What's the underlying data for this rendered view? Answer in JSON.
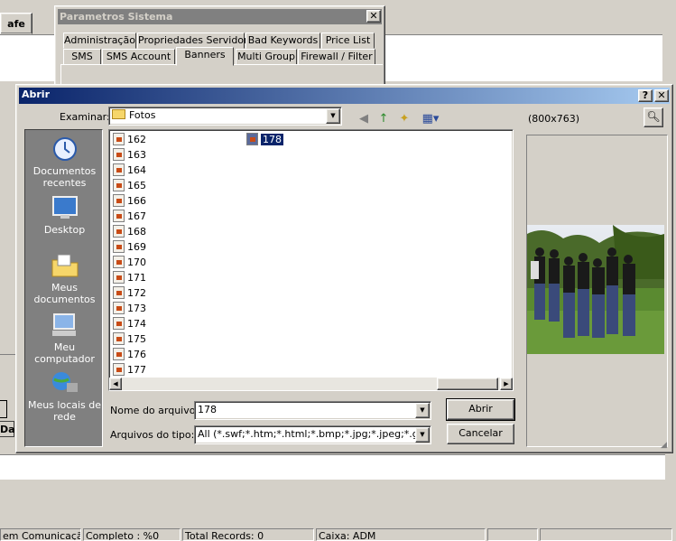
{
  "background": {
    "tab_label": "afe",
    "da_label": "Da"
  },
  "status_bar": {
    "cells": [
      "em Comunicação :",
      "Completo : %0",
      "Total Records: 0",
      "Caixa: ADM"
    ]
  },
  "param_dialog": {
    "title": "Parametros Sistema",
    "tabs_row1": [
      "Administração",
      "Propriedades Servidor",
      "Bad Keywords",
      "Price List"
    ],
    "tabs_row2": [
      "SMS",
      "SMS Account",
      "Banners",
      "Multi Group",
      "Firewall / Filter"
    ],
    "active_tab": "Banners"
  },
  "open_dialog": {
    "title": "Abrir",
    "help_btn": "?",
    "close_btn": "✕",
    "look_in_label": "Examinar:",
    "look_in_value": "Fotos",
    "preview_size": "(800x763)",
    "places": [
      {
        "label": "Documentos recentes",
        "icon": "recent-documents-icon"
      },
      {
        "label": "Desktop",
        "icon": "desktop-icon"
      },
      {
        "label": "Meus documentos",
        "icon": "my-documents-icon"
      },
      {
        "label": "Meu computador",
        "icon": "my-computer-icon"
      },
      {
        "label": "Meus locais de rede",
        "icon": "network-places-icon"
      }
    ],
    "files_col1": [
      "162",
      "163",
      "164",
      "165",
      "166",
      "167",
      "168",
      "169",
      "170",
      "171",
      "172",
      "173",
      "174",
      "175",
      "176",
      "177"
    ],
    "files_col2": [
      "178"
    ],
    "selected_file": "178",
    "filename_label": "Nome do arquivo:",
    "filename_value": "178",
    "filetype_label": "Arquivos do tipo:",
    "filetype_value": "All (*.swf;*.htm;*.html;*.bmp;*.jpg;*.jpeg;*.gif)",
    "open_button": "Abrir",
    "cancel_button": "Cancelar"
  }
}
